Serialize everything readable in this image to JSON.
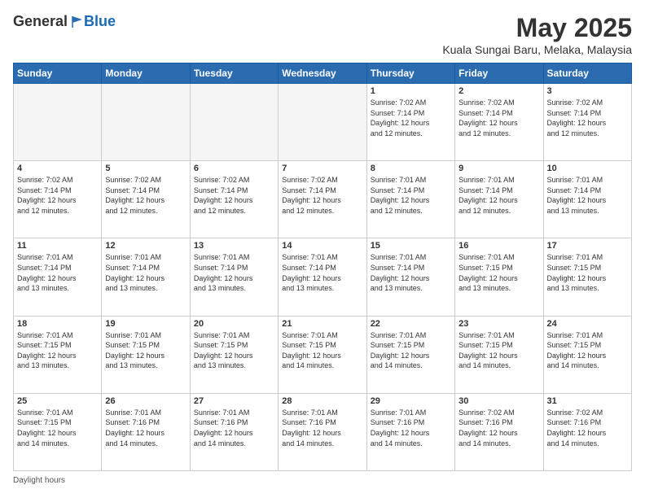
{
  "header": {
    "logo_general": "General",
    "logo_blue": "Blue",
    "month_title": "May 2025",
    "subtitle": "Kuala Sungai Baru, Melaka, Malaysia"
  },
  "footer": {
    "note": "Daylight hours"
  },
  "days_of_week": [
    "Sunday",
    "Monday",
    "Tuesday",
    "Wednesday",
    "Thursday",
    "Friday",
    "Saturday"
  ],
  "weeks": [
    [
      {
        "num": "",
        "info": ""
      },
      {
        "num": "",
        "info": ""
      },
      {
        "num": "",
        "info": ""
      },
      {
        "num": "",
        "info": ""
      },
      {
        "num": "1",
        "info": "Sunrise: 7:02 AM\nSunset: 7:14 PM\nDaylight: 12 hours\nand 12 minutes."
      },
      {
        "num": "2",
        "info": "Sunrise: 7:02 AM\nSunset: 7:14 PM\nDaylight: 12 hours\nand 12 minutes."
      },
      {
        "num": "3",
        "info": "Sunrise: 7:02 AM\nSunset: 7:14 PM\nDaylight: 12 hours\nand 12 minutes."
      }
    ],
    [
      {
        "num": "4",
        "info": "Sunrise: 7:02 AM\nSunset: 7:14 PM\nDaylight: 12 hours\nand 12 minutes."
      },
      {
        "num": "5",
        "info": "Sunrise: 7:02 AM\nSunset: 7:14 PM\nDaylight: 12 hours\nand 12 minutes."
      },
      {
        "num": "6",
        "info": "Sunrise: 7:02 AM\nSunset: 7:14 PM\nDaylight: 12 hours\nand 12 minutes."
      },
      {
        "num": "7",
        "info": "Sunrise: 7:02 AM\nSunset: 7:14 PM\nDaylight: 12 hours\nand 12 minutes."
      },
      {
        "num": "8",
        "info": "Sunrise: 7:01 AM\nSunset: 7:14 PM\nDaylight: 12 hours\nand 12 minutes."
      },
      {
        "num": "9",
        "info": "Sunrise: 7:01 AM\nSunset: 7:14 PM\nDaylight: 12 hours\nand 12 minutes."
      },
      {
        "num": "10",
        "info": "Sunrise: 7:01 AM\nSunset: 7:14 PM\nDaylight: 12 hours\nand 13 minutes."
      }
    ],
    [
      {
        "num": "11",
        "info": "Sunrise: 7:01 AM\nSunset: 7:14 PM\nDaylight: 12 hours\nand 13 minutes."
      },
      {
        "num": "12",
        "info": "Sunrise: 7:01 AM\nSunset: 7:14 PM\nDaylight: 12 hours\nand 13 minutes."
      },
      {
        "num": "13",
        "info": "Sunrise: 7:01 AM\nSunset: 7:14 PM\nDaylight: 12 hours\nand 13 minutes."
      },
      {
        "num": "14",
        "info": "Sunrise: 7:01 AM\nSunset: 7:14 PM\nDaylight: 12 hours\nand 13 minutes."
      },
      {
        "num": "15",
        "info": "Sunrise: 7:01 AM\nSunset: 7:14 PM\nDaylight: 12 hours\nand 13 minutes."
      },
      {
        "num": "16",
        "info": "Sunrise: 7:01 AM\nSunset: 7:15 PM\nDaylight: 12 hours\nand 13 minutes."
      },
      {
        "num": "17",
        "info": "Sunrise: 7:01 AM\nSunset: 7:15 PM\nDaylight: 12 hours\nand 13 minutes."
      }
    ],
    [
      {
        "num": "18",
        "info": "Sunrise: 7:01 AM\nSunset: 7:15 PM\nDaylight: 12 hours\nand 13 minutes."
      },
      {
        "num": "19",
        "info": "Sunrise: 7:01 AM\nSunset: 7:15 PM\nDaylight: 12 hours\nand 13 minutes."
      },
      {
        "num": "20",
        "info": "Sunrise: 7:01 AM\nSunset: 7:15 PM\nDaylight: 12 hours\nand 13 minutes."
      },
      {
        "num": "21",
        "info": "Sunrise: 7:01 AM\nSunset: 7:15 PM\nDaylight: 12 hours\nand 14 minutes."
      },
      {
        "num": "22",
        "info": "Sunrise: 7:01 AM\nSunset: 7:15 PM\nDaylight: 12 hours\nand 14 minutes."
      },
      {
        "num": "23",
        "info": "Sunrise: 7:01 AM\nSunset: 7:15 PM\nDaylight: 12 hours\nand 14 minutes."
      },
      {
        "num": "24",
        "info": "Sunrise: 7:01 AM\nSunset: 7:15 PM\nDaylight: 12 hours\nand 14 minutes."
      }
    ],
    [
      {
        "num": "25",
        "info": "Sunrise: 7:01 AM\nSunset: 7:15 PM\nDaylight: 12 hours\nand 14 minutes."
      },
      {
        "num": "26",
        "info": "Sunrise: 7:01 AM\nSunset: 7:16 PM\nDaylight: 12 hours\nand 14 minutes."
      },
      {
        "num": "27",
        "info": "Sunrise: 7:01 AM\nSunset: 7:16 PM\nDaylight: 12 hours\nand 14 minutes."
      },
      {
        "num": "28",
        "info": "Sunrise: 7:01 AM\nSunset: 7:16 PM\nDaylight: 12 hours\nand 14 minutes."
      },
      {
        "num": "29",
        "info": "Sunrise: 7:01 AM\nSunset: 7:16 PM\nDaylight: 12 hours\nand 14 minutes."
      },
      {
        "num": "30",
        "info": "Sunrise: 7:02 AM\nSunset: 7:16 PM\nDaylight: 12 hours\nand 14 minutes."
      },
      {
        "num": "31",
        "info": "Sunrise: 7:02 AM\nSunset: 7:16 PM\nDaylight: 12 hours\nand 14 minutes."
      }
    ]
  ]
}
